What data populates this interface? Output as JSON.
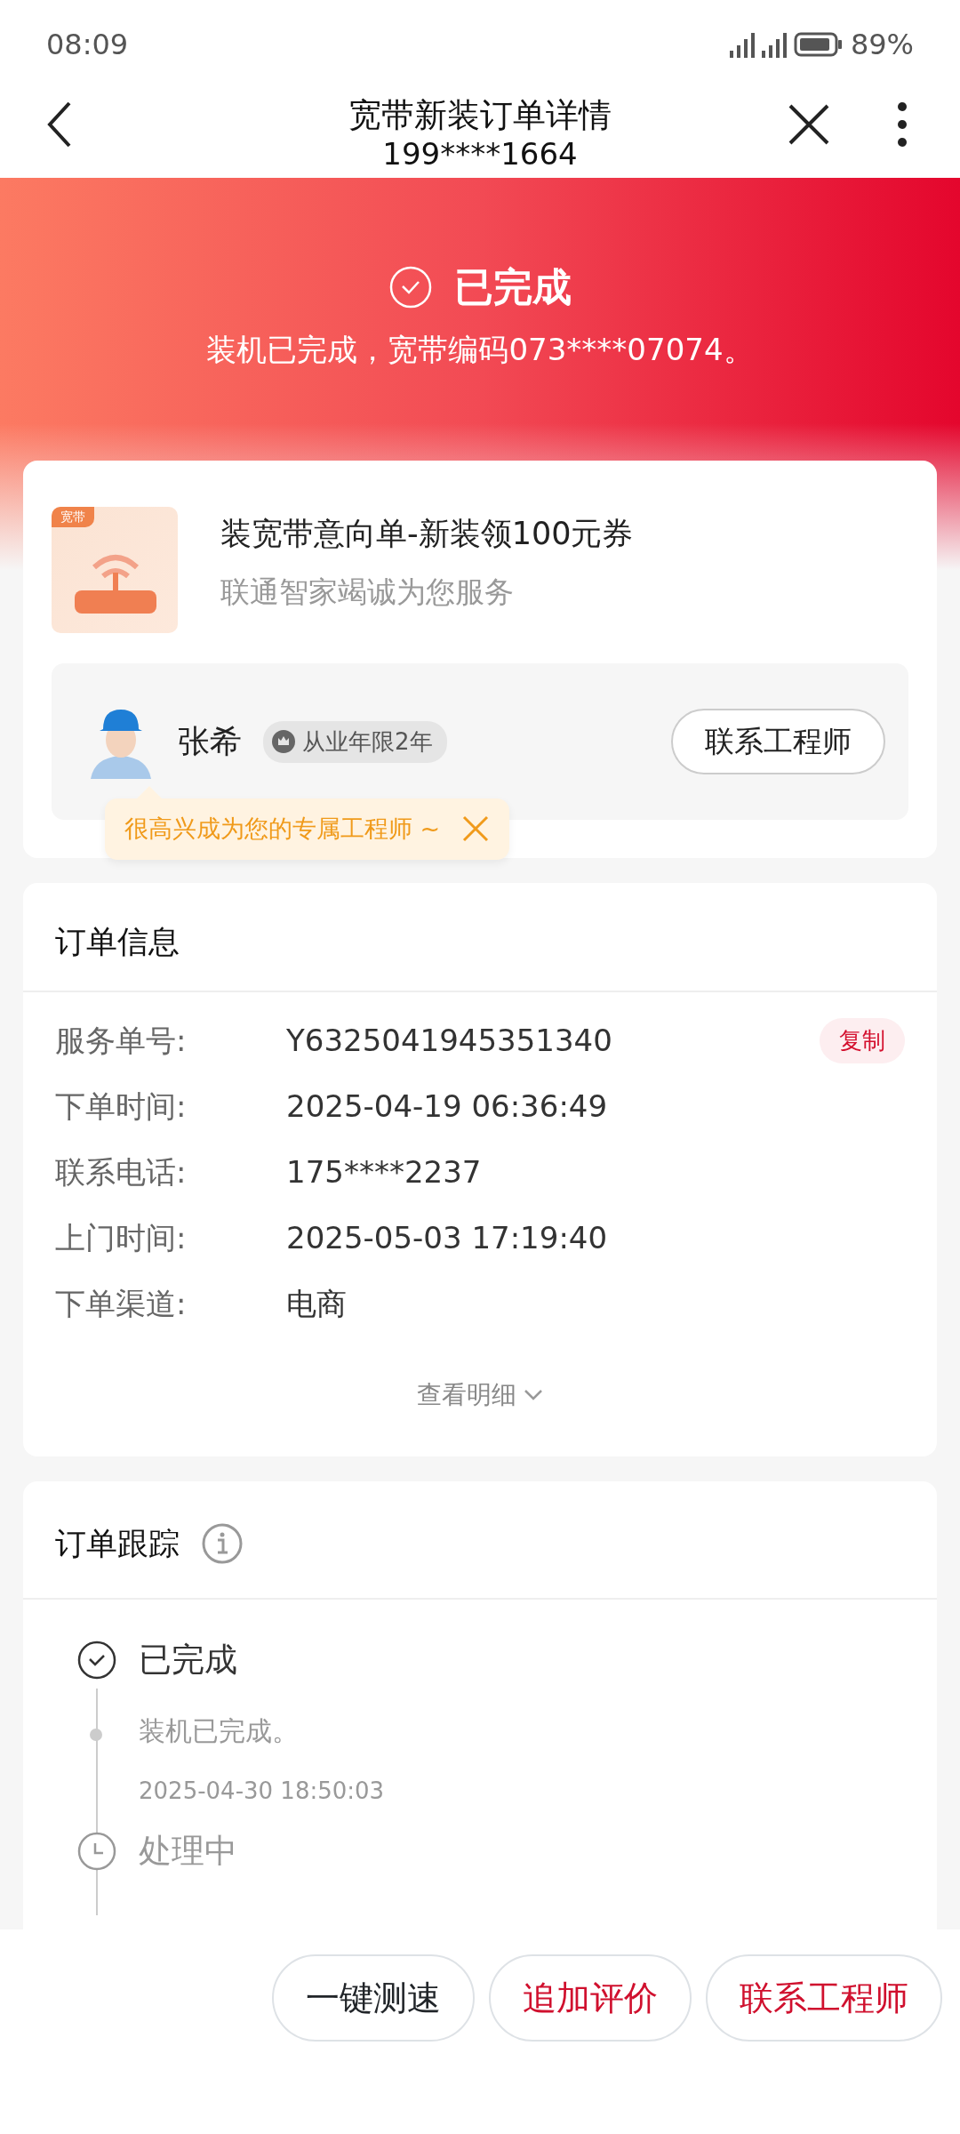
{
  "status_bar": {
    "time": "08:09",
    "battery": "89%"
  },
  "header": {
    "title": "宽带新装订单详情",
    "subtitle": "199****1664"
  },
  "hero": {
    "status": "已完成",
    "message": "装机已完成，宽带编码073****07074。"
  },
  "product": {
    "badge": "宽带",
    "title": "装宽带意向单-新装领100元券",
    "subtitle": "联通智家竭诚为您服务"
  },
  "engineer": {
    "name": "张希",
    "tag": "从业年限2年",
    "button": "联系工程师",
    "tooltip": "很高兴成为您的专属工程师 ~"
  },
  "order_info": {
    "title": "订单信息",
    "rows": [
      {
        "label": "服务单号:",
        "value": "Y6325041945351340",
        "action": "复制"
      },
      {
        "label": "下单时间:",
        "value": "2025-04-19 06:36:49"
      },
      {
        "label": "联系电话:",
        "value": "175****2237"
      },
      {
        "label": "上门时间:",
        "value": "2025-05-03 17:19:40"
      },
      {
        "label": "下单渠道:",
        "value": "电商"
      }
    ],
    "more": "查看明细"
  },
  "tracking": {
    "title": "订单跟踪",
    "steps": [
      {
        "title": "已完成",
        "kind": "done",
        "events": [
          {
            "text": "装机已完成。",
            "time": "2025-04-30 18:50:03"
          }
        ]
      },
      {
        "title": "处理中",
        "kind": "processing"
      }
    ]
  },
  "bottom_buttons": [
    {
      "label": "一键测速",
      "kind": "outline"
    },
    {
      "label": "追加评价",
      "kind": "primary"
    },
    {
      "label": "联系工程师",
      "kind": "primary"
    }
  ]
}
